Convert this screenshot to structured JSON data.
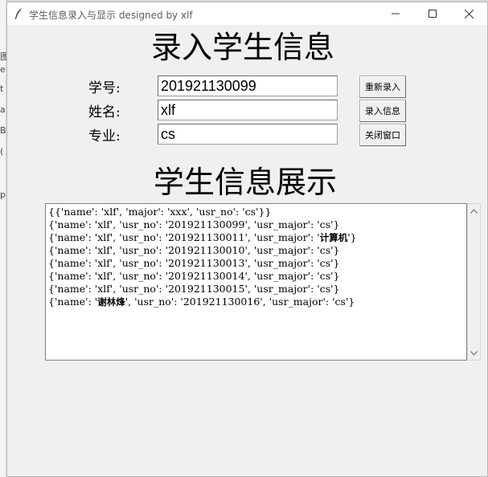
{
  "window": {
    "title": "学生信息录入与显示 designed by xlf"
  },
  "entry_form": {
    "heading": "录入学生信息",
    "student_id": {
      "label": "学号:",
      "value": "201921130099"
    },
    "name": {
      "label": "姓名:",
      "value": "xlf"
    },
    "major": {
      "label": "专业:",
      "value": "cs"
    }
  },
  "buttons": {
    "reset": "重新录入",
    "submit": "录入信息",
    "close": "关闭窗口"
  },
  "display": {
    "heading": "学生信息展示",
    "records": [
      {
        "pre": "{{'name': 'xlf', 'major': 'xxx', 'usr_no': 'cs'}}",
        "bold": "",
        "post": ""
      },
      {
        "pre": "{'name': 'xlf', 'usr_no': '201921130099', 'usr_major': 'cs'}",
        "bold": "",
        "post": ""
      },
      {
        "pre": "{'name': 'xlf', 'usr_no': '201921130011', 'usr_major': '",
        "bold": "计算机",
        "post": "'}"
      },
      {
        "pre": "{'name': 'xlf', 'usr_no': '201921130010', 'usr_major': 'cs'}",
        "bold": "",
        "post": ""
      },
      {
        "pre": "{'name': 'xlf', 'usr_no': '201921130013', 'usr_major': 'cs'}",
        "bold": "",
        "post": ""
      },
      {
        "pre": "{'name': 'xlf', 'usr_no': '201921130014', 'usr_major': 'cs'}",
        "bold": "",
        "post": ""
      },
      {
        "pre": "{'name': 'xlf', 'usr_no': '201921130015', 'usr_major': 'cs'}",
        "bold": "",
        "post": ""
      },
      {
        "pre": "{'name': '",
        "bold": "谢林烽",
        "post": "', 'usr_no': '201921130016', 'usr_major': 'cs'}"
      }
    ]
  },
  "background_glyphs": [
    "图",
    "e",
    "t",
    "a",
    "B",
    "(",
    "p"
  ],
  "icons": {
    "app": "feather-icon",
    "minimize": "minimize-icon",
    "maximize": "maximize-icon",
    "close": "close-icon",
    "scroll_up": "chevron-up-icon",
    "scroll_down": "chevron-down-icon"
  }
}
